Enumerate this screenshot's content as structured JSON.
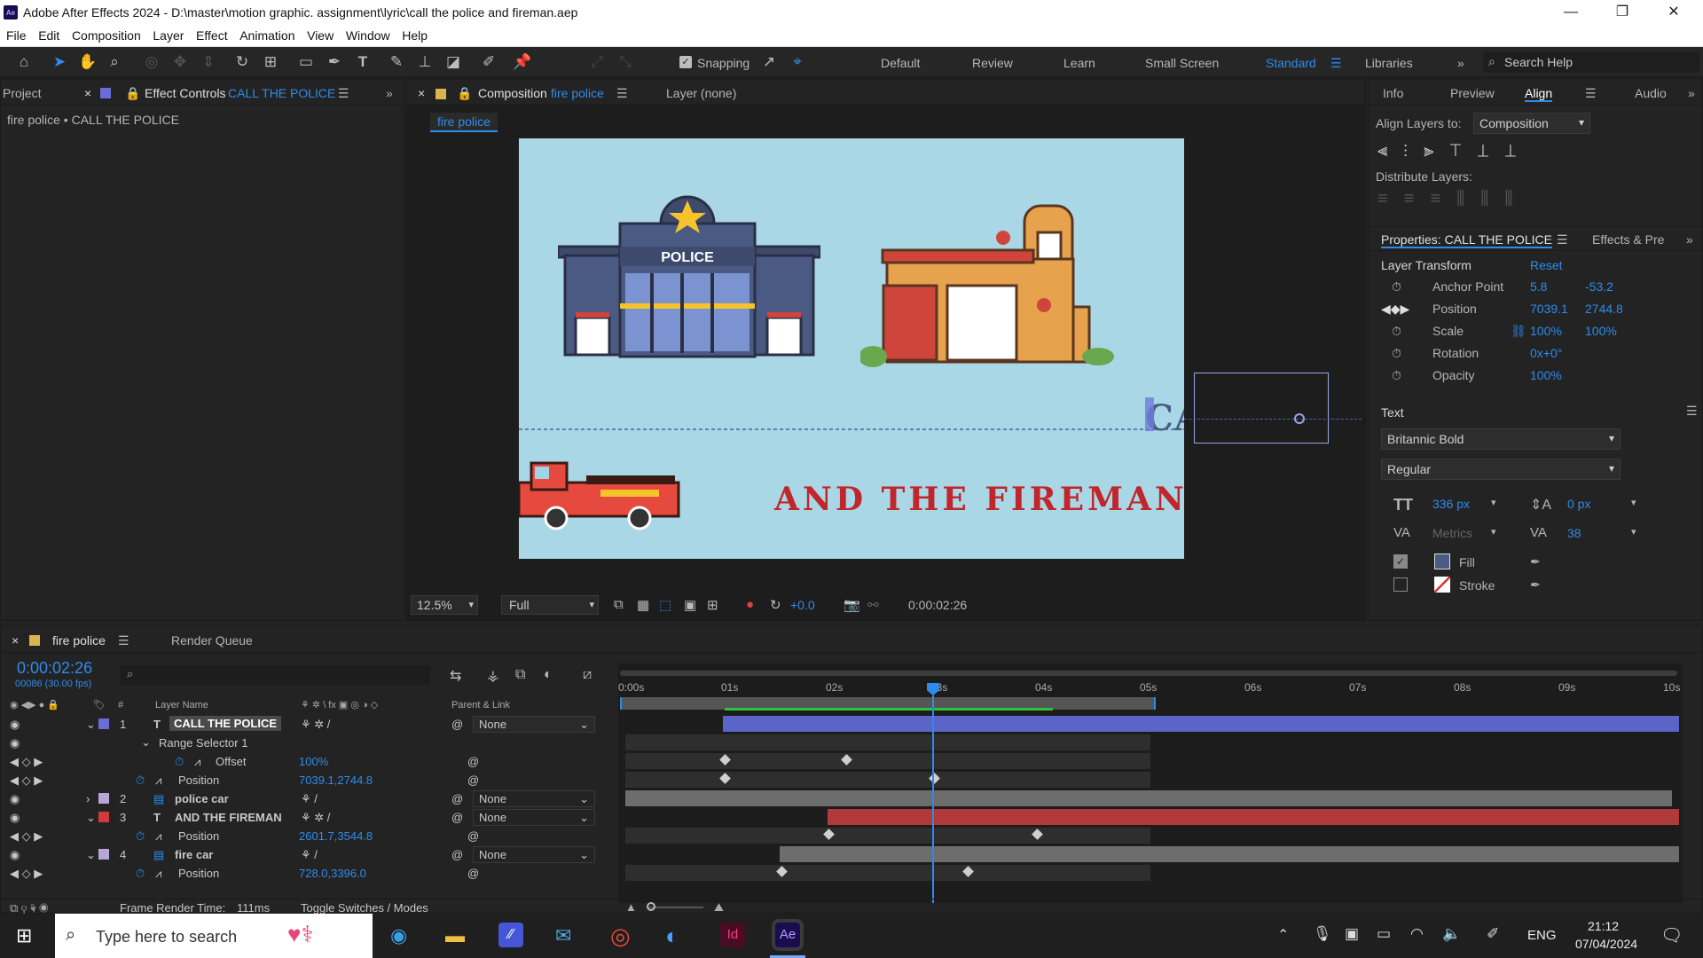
{
  "app": {
    "title": "Adobe After Effects 2024 - D:\\master\\motion graphic. assignment\\lyric\\call the police and fireman.aep",
    "logo": "Ae",
    "window_controls": [
      "—",
      "❐",
      "✕"
    ]
  },
  "menu": [
    "File",
    "Edit",
    "Composition",
    "Layer",
    "Effect",
    "Animation",
    "View",
    "Window",
    "Help"
  ],
  "toolbar": {
    "snapping_label": "Snapping",
    "workspaces": [
      "Default",
      "Review",
      "Learn",
      "Small Screen",
      "Standard",
      "Libraries"
    ],
    "active_workspace": "Standard",
    "search_placeholder": "Search Help"
  },
  "left_panel": {
    "tab_project": "Project",
    "tab_effect_controls_prefix": "Effect Controls",
    "tab_effect_controls_layer": "CALL THE POLICE",
    "breadcrumb": "fire police • CALL THE POLICE"
  },
  "comp_panel": {
    "tab_prefix": "Composition",
    "tab_name": "fire police",
    "layer_tab": "Layer  (none)",
    "comp_chip": "fire police",
    "police_sign": "POLICE",
    "canvas_text_ca": "CA",
    "canvas_text_fireman": "AND THE FIREMAN",
    "zoom": "12.5%",
    "resolution": "Full",
    "exposure": "+0.0",
    "timecode": "0:00:02:26"
  },
  "right_panel": {
    "tabs": [
      "Info",
      "Preview",
      "Align",
      "Audio"
    ],
    "align_layers_to_label": "Align Layers to:",
    "align_layers_to_value": "Composition",
    "distribute_label": "Distribute Layers:",
    "properties_title": "Properties: CALL THE POLICE",
    "effects_tab": "Effects & Pre",
    "layer_transform": "Layer Transform",
    "reset": "Reset",
    "anchor_label": "Anchor Point",
    "anchor_x": "5.8",
    "anchor_y": "-53.2",
    "position_label": "Position",
    "position_x": "7039.1",
    "position_y": "2744.8",
    "scale_label": "Scale",
    "scale_x": "100%",
    "scale_y": "100%",
    "rotation_label": "Rotation",
    "rotation_val": "0x+0°",
    "opacity_label": "Opacity",
    "opacity_val": "100%",
    "text_section": "Text",
    "font_family": "Britannic Bold",
    "font_style": "Regular",
    "font_size": "336 px",
    "leading": "0 px",
    "kerning": "Metrics",
    "tracking": "38",
    "fill_label": "Fill",
    "stroke_label": "Stroke"
  },
  "timeline": {
    "tab_comp": "fire police",
    "tab_render": "Render Queue",
    "timecode": "0:00:02:26",
    "frame_info": "00086 (30.00 fps)",
    "col_layer_name": "Layer Name",
    "col_parent": "Parent & Link",
    "ruler": [
      "0:00s",
      "01s",
      "02s",
      "03s",
      "04s",
      "05s",
      "06s",
      "07s",
      "08s",
      "09s",
      "10s"
    ],
    "rows": [
      {
        "num": "1",
        "name": "CALL THE POLICE",
        "parent": "None",
        "kind": "layer"
      },
      {
        "name": "Range Selector 1",
        "kind": "group"
      },
      {
        "name": "Offset",
        "value": "100%",
        "kind": "prop"
      },
      {
        "name": "Position",
        "value": "7039.1,2744.8",
        "kind": "prop"
      },
      {
        "num": "2",
        "name": "police car",
        "parent": "None",
        "kind": "layer"
      },
      {
        "num": "3",
        "name": "AND THE FIREMAN",
        "parent": "None",
        "kind": "layer"
      },
      {
        "name": "Position",
        "value": "2601.7,3544.8",
        "kind": "prop"
      },
      {
        "num": "4",
        "name": "fire car",
        "parent": "None",
        "kind": "layer"
      },
      {
        "name": "Position",
        "value": "728.0,3396.0",
        "kind": "prop"
      }
    ],
    "frame_render_label": "Frame Render Time:",
    "frame_render_value": "111ms",
    "toggle_label": "Toggle Switches / Modes"
  },
  "taskbar": {
    "search_placeholder": "Type here to search",
    "lang": "ENG",
    "time": "21:12",
    "date": "07/04/2024",
    "apps": [
      "Edge",
      "File Explorer",
      "Affinity",
      "Mail",
      "Chrome",
      "App",
      "InDesign",
      "After Effects"
    ]
  },
  "colors": {
    "accent": "#2d8ceb",
    "canvas_bg": "#a9d7e5",
    "layer1_bar": "#5b64c7",
    "layer3_bar": "#b03a3a",
    "fireman_text": "#c0262b"
  }
}
